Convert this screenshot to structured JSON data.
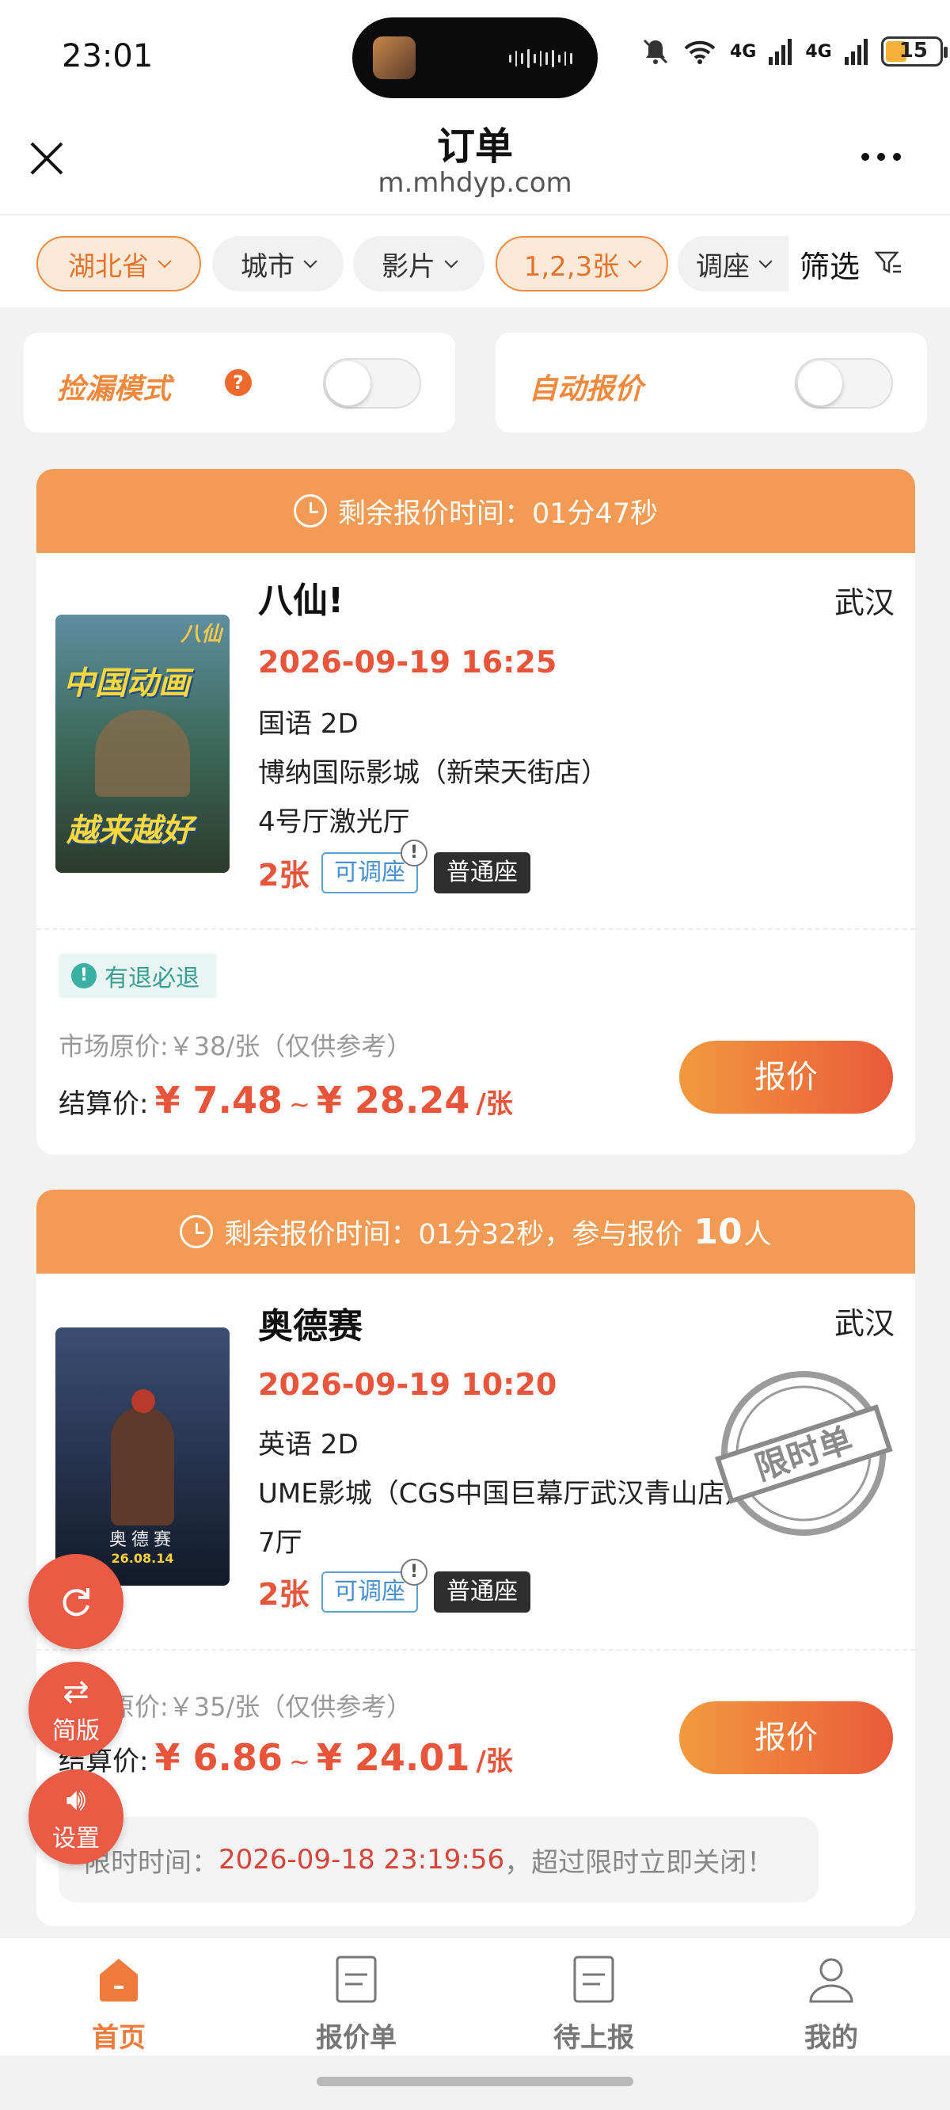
{
  "status_bar": {
    "time": "23:01",
    "network_1": "4G",
    "network_2": "4G",
    "battery": "15"
  },
  "header": {
    "title": "订单",
    "subtitle": "m.mhdyp.com"
  },
  "filters": {
    "province": "湖北省",
    "city": "城市",
    "movie": "影片",
    "tickets": "1,2,3张",
    "seat": "调座",
    "filter_label": "筛选"
  },
  "toggles": {
    "bargain_mode": "捡漏模式",
    "auto_quote": "自动报价"
  },
  "orders": [
    {
      "banner": "剩余报价时间：01分47秒",
      "title": "八仙!",
      "city": "武汉",
      "showtime": "2026-09-19 16:25",
      "language": "国语 2D",
      "cinema": "博纳国际影城（新荣天街店）",
      "hall": "4号厅激光厅",
      "tickets": "2张",
      "adjust_tag": "可调座",
      "seat_tag": "普通座",
      "refund": "有退必退",
      "market_price": "市场原价:￥38/张（仅供参考）",
      "settle_label": "结算价:",
      "price_low": "¥ 7.48",
      "price_high": "¥ 28.24",
      "price_unit": "/张",
      "quote_button": "报价",
      "poster_text_1": "中国动画",
      "poster_text_2": "越来越好",
      "poster_logo": "八仙"
    },
    {
      "banner_prefix": "剩余报价时间：01分32秒，参与报价",
      "banner_count": "10",
      "banner_suffix": "人",
      "title": "奥德赛",
      "city": "武汉",
      "showtime": "2026-09-19 10:20",
      "language": "英语 2D",
      "cinema": "UME影城（CGS中国巨幕厅武汉青山店）",
      "hall": "7厅",
      "tickets": "2张",
      "adjust_tag": "可调座",
      "seat_tag": "普通座",
      "stamp": "限时单",
      "market_price": "市场原价:￥35/张（仅供参考）",
      "settle_label": "结算价:",
      "price_low": "¥ 6.86",
      "price_high": "¥ 24.01",
      "price_unit": "/张",
      "quote_button": "报价",
      "limit_label": "限时时间：",
      "limit_time": "2026-09-18 23:19:56",
      "limit_suffix": "，超过限时立即关闭！",
      "poster_title": "奥德赛",
      "poster_date": "26.08.14"
    }
  ],
  "fab": {
    "refresh": "",
    "simple": "简版",
    "settings": "设置"
  },
  "nav": [
    {
      "label": "首页",
      "active": true
    },
    {
      "label": "报价单",
      "active": false
    },
    {
      "label": "待上报",
      "active": false
    },
    {
      "label": "我的",
      "active": false
    }
  ],
  "colors": {
    "accent": "#f39a55",
    "price": "#e8553a",
    "brand_orange": "#ee7a3c"
  }
}
